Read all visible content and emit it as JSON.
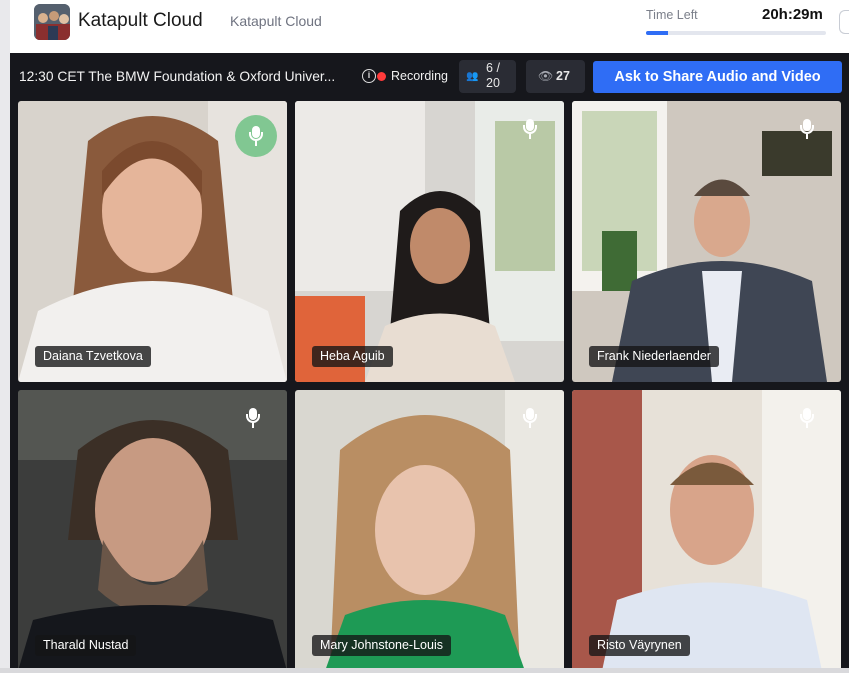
{
  "header": {
    "app_name": "Katapult Cloud",
    "app_subtitle": "Katapult Cloud",
    "time_left_label": "Time Left",
    "time_left_value": "20h:29m",
    "time_left_progress": 0.12,
    "accent_color": "#2f6df5"
  },
  "meeting": {
    "title": "12:30 CET The BMW Foundation & Oxford Univer...",
    "info_icon": "info-icon",
    "recording_label": "Recording",
    "recording_color": "#ff3b3b",
    "participants_count": "6 / 20",
    "viewers_count": "27",
    "share_button_label": "Ask to Share Audio and Video"
  },
  "participants": [
    {
      "name": "Daiana Tzvetkova",
      "mic": "speaking"
    },
    {
      "name": "Heba Aguib",
      "mic": "on"
    },
    {
      "name": "Frank Niederlaender",
      "mic": "on"
    },
    {
      "name": "Tharald Nustad",
      "mic": "on"
    },
    {
      "name": "Mary Johnstone-Louis",
      "mic": "on"
    },
    {
      "name": "Risto Väyrynen",
      "mic": "on"
    }
  ]
}
